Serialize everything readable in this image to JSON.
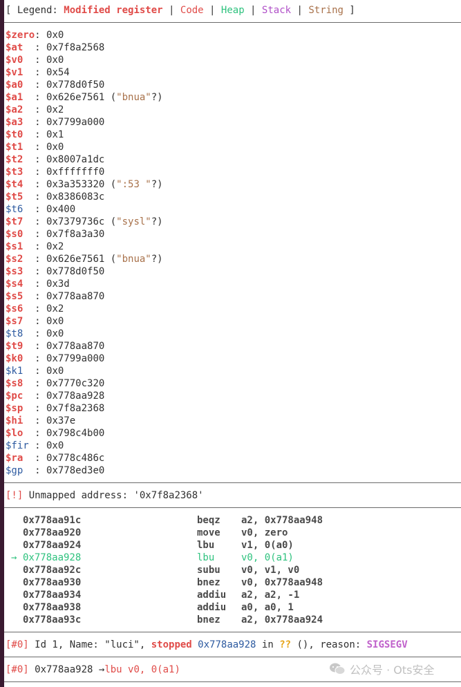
{
  "legend": {
    "prefix": "[ Legend: ",
    "modified": "Modified register",
    "code": "Code",
    "heap": "Heap",
    "stack": "Stack",
    "string": "String",
    "suffix": " ]",
    "bar": " | "
  },
  "registers": [
    {
      "name": "$zero",
      "pad": "",
      "value": ": 0x0",
      "style": "red"
    },
    {
      "name": "$at",
      "pad": "  ",
      "value": ": 0x7f8a2568",
      "style": "red"
    },
    {
      "name": "$v0",
      "pad": "  ",
      "value": ": 0x0",
      "style": "red"
    },
    {
      "name": "$v1",
      "pad": "  ",
      "value": ": 0x54",
      "style": "red"
    },
    {
      "name": "$a0",
      "pad": "  ",
      "value": ": 0x778d0f50",
      "style": "red"
    },
    {
      "name": "$a1",
      "pad": "  ",
      "value": ": 0x626e7561 (",
      "str": "\"bnua\"",
      "after": "?)",
      "style": "red"
    },
    {
      "name": "$a2",
      "pad": "  ",
      "value": ": 0x2",
      "style": "red"
    },
    {
      "name": "$a3",
      "pad": "  ",
      "value": ": 0x7799a000",
      "style": "red"
    },
    {
      "name": "$t0",
      "pad": "  ",
      "value": ": 0x1",
      "style": "red"
    },
    {
      "name": "$t1",
      "pad": "  ",
      "value": ": 0x0",
      "style": "red"
    },
    {
      "name": "$t2",
      "pad": "  ",
      "value": ": 0x8007a1dc",
      "style": "red"
    },
    {
      "name": "$t3",
      "pad": "  ",
      "value": ": 0xfffffff0",
      "style": "red"
    },
    {
      "name": "$t4",
      "pad": "  ",
      "value": ": 0x3a353320 (",
      "str": "\":53 \"",
      "after": "?)",
      "style": "red"
    },
    {
      "name": "$t5",
      "pad": "  ",
      "value": ": 0x8386083c",
      "style": "red"
    },
    {
      "name": "$t6",
      "pad": "  ",
      "value": ": 0x400",
      "style": "blue"
    },
    {
      "name": "$t7",
      "pad": "  ",
      "value": ": 0x7379736c (",
      "str": "\"sysl\"",
      "after": "?)",
      "style": "red"
    },
    {
      "name": "$s0",
      "pad": "  ",
      "value": ": 0x7f8a3a30",
      "style": "red"
    },
    {
      "name": "$s1",
      "pad": "  ",
      "value": ": 0x2",
      "style": "red"
    },
    {
      "name": "$s2",
      "pad": "  ",
      "value": ": 0x626e7561 (",
      "str": "\"bnua\"",
      "after": "?)",
      "style": "red"
    },
    {
      "name": "$s3",
      "pad": "  ",
      "value": ": 0x778d0f50",
      "style": "red"
    },
    {
      "name": "$s4",
      "pad": "  ",
      "value": ": 0x3d",
      "style": "red"
    },
    {
      "name": "$s5",
      "pad": "  ",
      "value": ": 0x778aa870",
      "style": "red"
    },
    {
      "name": "$s6",
      "pad": "  ",
      "value": ": 0x2",
      "style": "red"
    },
    {
      "name": "$s7",
      "pad": "  ",
      "value": ": 0x0",
      "style": "red"
    },
    {
      "name": "$t8",
      "pad": "  ",
      "value": ": 0x0",
      "style": "blue"
    },
    {
      "name": "$t9",
      "pad": "  ",
      "value": ": 0x778aa870",
      "style": "red"
    },
    {
      "name": "$k0",
      "pad": "  ",
      "value": ": 0x7799a000",
      "style": "red"
    },
    {
      "name": "$k1",
      "pad": "  ",
      "value": ": 0x0",
      "style": "blue"
    },
    {
      "name": "$s8",
      "pad": "  ",
      "value": ": 0x7770c320",
      "style": "red"
    },
    {
      "name": "$pc",
      "pad": "  ",
      "value": ": 0x778aa928",
      "style": "red"
    },
    {
      "name": "$sp",
      "pad": "  ",
      "value": ": 0x7f8a2368",
      "style": "red"
    },
    {
      "name": "$hi",
      "pad": "  ",
      "value": ": 0x37e",
      "style": "red"
    },
    {
      "name": "$lo",
      "pad": "  ",
      "value": ": 0x798c4b00",
      "style": "red"
    },
    {
      "name": "$fir",
      "pad": " ",
      "value": ": 0x0",
      "style": "blue"
    },
    {
      "name": "$ra",
      "pad": "  ",
      "value": ": 0x778c486c",
      "style": "red"
    },
    {
      "name": "$gp",
      "pad": "  ",
      "value": ": 0x778ed3e0",
      "style": "blue"
    }
  ],
  "unmapped": {
    "tag": "[!]",
    "text": " Unmapped address: '0x7f8a2368'"
  },
  "asm": [
    {
      "addr": "0x778aa91c",
      "mn": "beqz",
      "ops": "a2, 0x778aa948",
      "current": false
    },
    {
      "addr": "0x778aa920",
      "mn": "move",
      "ops": "v0, zero",
      "current": false
    },
    {
      "addr": "0x778aa924",
      "mn": "lbu",
      "ops": "v1, 0(a0)",
      "current": false
    },
    {
      "addr": "0x778aa928",
      "mn": "lbu",
      "ops": "v0, 0(a1)",
      "current": true
    },
    {
      "addr": "0x778aa92c",
      "mn": "subu",
      "ops": "v0, v1, v0",
      "current": false
    },
    {
      "addr": "0x778aa930",
      "mn": "bnez",
      "ops": "v0, 0x778aa948",
      "current": false
    },
    {
      "addr": "0x778aa934",
      "mn": "addiu",
      "ops": "a2, a2, -1",
      "current": false
    },
    {
      "addr": "0x778aa938",
      "mn": "addiu",
      "ops": "a0, a0, 1",
      "current": false
    },
    {
      "addr": "0x778aa93c",
      "mn": "bnez",
      "ops": "a2, 0x778aa924",
      "current": false
    }
  ],
  "arrow": "→",
  "thread": {
    "tag": "[#0]",
    "p1": " Id 1, Name: \"luci\", ",
    "stopped": "stopped",
    "addr": " 0x778aa928",
    "p2": " in ",
    "unknown": "??",
    "p3": " (), reason: ",
    "reason": "SIGSEGV"
  },
  "trace": {
    "tag": "[#0]",
    "addr": " 0x778aa928 ",
    "arrow": "→",
    "instr": "lbu v0, 0(a1)"
  },
  "watermark": {
    "text": "公众号 · Ots安全"
  },
  "colors": {
    "modified": "#e04b48",
    "code": "#e04b48",
    "heap": "#2ec27e",
    "stack": "#b050c8",
    "string": "#a8714a",
    "unchanged": "#2d5aa0"
  }
}
